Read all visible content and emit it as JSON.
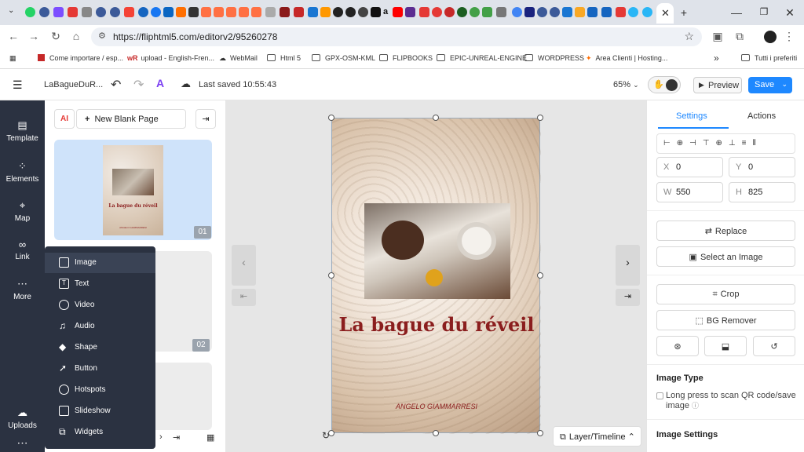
{
  "browser": {
    "url": "https://fliphtml5.com/editorv2/95260278",
    "bookmarks": [
      "Come importare / esp...",
      "upload - English-Fren...",
      "WebMail",
      "Html 5",
      "GPX-OSM-KML",
      "FLIPBOOKS",
      "EPIC-UNREAL-ENGINE",
      "WORDPRESS",
      "Area Clienti | Hosting...",
      "Tutti i preferiti"
    ],
    "overflow": "»"
  },
  "header": {
    "doc_title": "LaBagueDuR...",
    "saved": "Last saved 10:55:43",
    "zoom": "65%",
    "preview": "Preview",
    "save": "Save"
  },
  "rail": [
    {
      "label": "Template"
    },
    {
      "label": "Elements"
    },
    {
      "label": "Map"
    },
    {
      "label": "Link"
    },
    {
      "label": "More"
    },
    {
      "label": "Uploads"
    }
  ],
  "pages": {
    "new_blank": "New Blank Page",
    "ai": "AI",
    "page_nums": [
      "01",
      "02"
    ]
  },
  "element_menu": [
    "Image",
    "Text",
    "Video",
    "Audio",
    "Shape",
    "Button",
    "Hotspots",
    "Slideshow",
    "Widgets"
  ],
  "book": {
    "title": "La bague du réveil",
    "author": "ANGELO GIAMMARRESI",
    "thumb_title": "La bague du réveil",
    "thumb_author": "ANGELO GIAMMARRESI"
  },
  "layer_timeline": "Layer/Timeline",
  "right": {
    "tabs": [
      "Settings",
      "Actions"
    ],
    "x_label": "X",
    "x": "0",
    "y_label": "Y",
    "y": "0",
    "w_label": "W",
    "w": "550",
    "h_label": "H",
    "h": "825",
    "replace": "Replace",
    "select_image": "Select an Image",
    "crop": "Crop",
    "bg_remover": "BG Remover",
    "image_type": "Image Type",
    "qr_label": "Long press to scan QR code/save image",
    "image_settings": "Image Settings"
  }
}
